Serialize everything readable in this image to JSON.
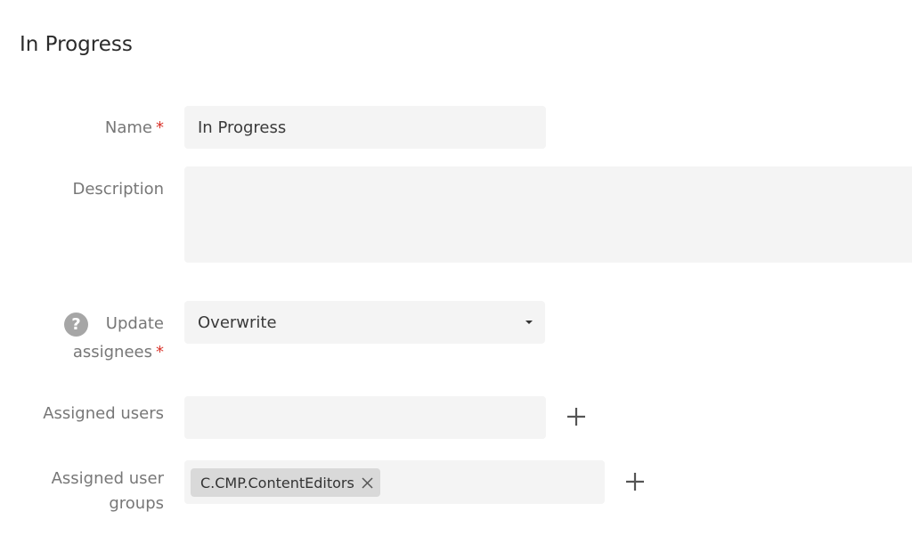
{
  "page": {
    "title": "In Progress"
  },
  "form": {
    "name": {
      "label": "Name",
      "required_mark": "*",
      "value": "In Progress"
    },
    "description": {
      "label": "Description",
      "value": ""
    },
    "update_assignees": {
      "label_line1": "Update",
      "label_line2": "assignees",
      "required_mark": "*",
      "help_icon": "question-circle-icon",
      "help_glyph": "?",
      "selected": "Overwrite"
    },
    "assigned_users": {
      "label": "Assigned users",
      "value": "",
      "add_icon": "plus-icon"
    },
    "assigned_user_groups": {
      "label_line1": "Assigned user",
      "label_line2": "groups",
      "chips": [
        {
          "label": "C.CMP.ContentEditors",
          "remove_icon": "close-icon"
        }
      ],
      "add_icon": "plus-icon"
    }
  },
  "colors": {
    "required": "#d9342b",
    "field_background": "#f4f4f4",
    "chip_background": "#d9d9d9",
    "help_icon": "#a6a6a6"
  }
}
